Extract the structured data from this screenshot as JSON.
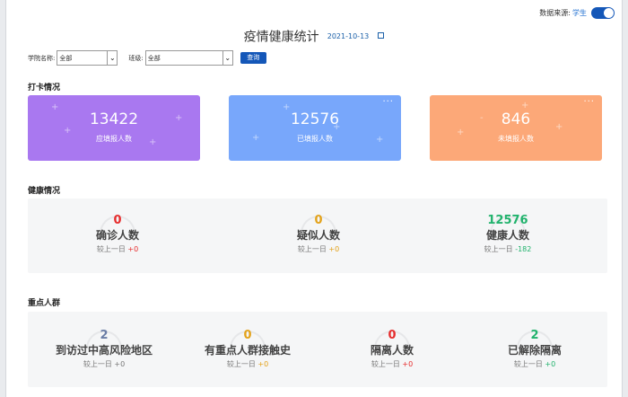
{
  "topbar": {
    "source_label": "数据来源:",
    "source_value": "学生"
  },
  "header": {
    "title": "疫情健康统计",
    "date": "2021-10-13"
  },
  "filters": {
    "college_label": "学院名称:",
    "college_value": "全部",
    "class_label": "班级:",
    "class_value": "全部",
    "query_label": "查询"
  },
  "checkin": {
    "title": "打卡情况",
    "cards": [
      {
        "value": "13422",
        "label": "应填报人数",
        "color": "#a978f0"
      },
      {
        "value": "12576",
        "label": "已填报人数",
        "color": "#78a7fb",
        "more": "···"
      },
      {
        "value": "846",
        "label": "未填报人数",
        "color": "#fca878",
        "more": "···"
      }
    ]
  },
  "health": {
    "title": "健康情况",
    "items": [
      {
        "value": "0",
        "name": "确诊人数",
        "delta_label": "较上一日",
        "delta": "+0"
      },
      {
        "value": "0",
        "name": "疑似人数",
        "delta_label": "较上一日",
        "delta": "+0"
      },
      {
        "value": "12576",
        "name": "健康人数",
        "delta_label": "较上一日",
        "delta": "-182"
      }
    ]
  },
  "key_groups": {
    "title": "重点人群",
    "items": [
      {
        "value": "2",
        "name": "到访过中高风险地区",
        "delta_label": "较上一日",
        "delta": "+0"
      },
      {
        "value": "0",
        "name": "有重点人群接触史",
        "delta_label": "较上一日",
        "delta": "+0"
      },
      {
        "value": "0",
        "name": "隔离人数",
        "delta_label": "较上一日",
        "delta": "+0"
      },
      {
        "value": "2",
        "name": "已解除隔离",
        "delta_label": "较上一日",
        "delta": "+0"
      }
    ]
  }
}
